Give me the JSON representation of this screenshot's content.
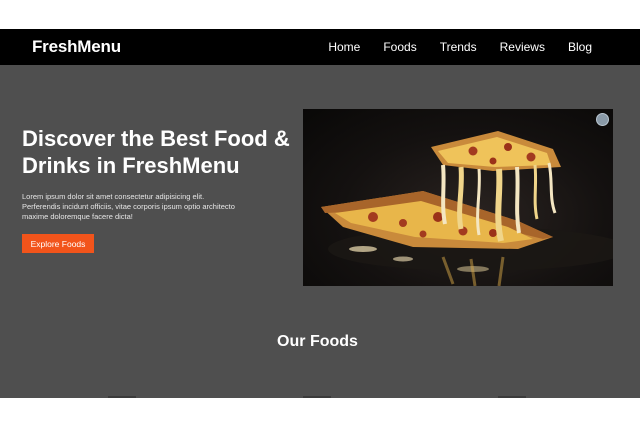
{
  "brand": {
    "name": "FreshMenu"
  },
  "nav": {
    "items": [
      "Home",
      "Foods",
      "Trends",
      "Reviews",
      "Blog"
    ]
  },
  "hero": {
    "title": "Discover the Best Food & Drinks in FreshMenu",
    "description": "Lorem ipsum dolor sit amet consectetur adipisicing elit. Perferendis incidunt officiis, vitae corporis ipsum optio architecto maxime doloremque facere dicta!",
    "cta_label": "Explore Foods",
    "image_icon": "pizza-image"
  },
  "section": {
    "title": "Our Foods"
  },
  "colors": {
    "navbar": "#000000",
    "hero_background": "#4f4f4f",
    "accent": "#f2541b",
    "text": "#ffffff"
  }
}
